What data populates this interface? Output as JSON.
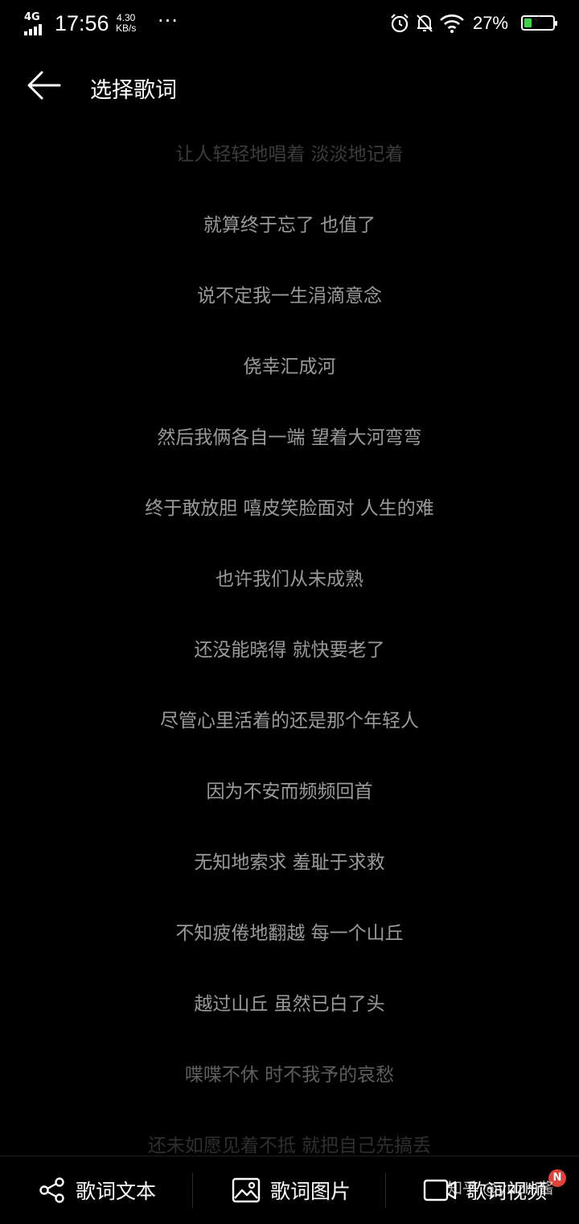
{
  "status_bar": {
    "network": "4G",
    "time": "17:56",
    "speed_value": "4.30",
    "speed_unit": "KB/s",
    "more": "···",
    "battery_percent": "27%",
    "battery_level": 0.27,
    "battery_color": "#3fd24a",
    "icons": [
      "alarm-icon",
      "notifications-off-icon",
      "wifi-icon",
      "battery-charging-icon"
    ]
  },
  "header": {
    "title": "选择歌词",
    "back_icon": "arrow-left-icon"
  },
  "lyrics": [
    "让人轻轻地唱着 淡淡地记着",
    "就算终于忘了 也值了",
    "说不定我一生涓滴意念",
    "侥幸汇成河",
    "然后我俩各自一端 望着大河弯弯",
    "终于敢放胆 嘻皮笑脸面对 人生的难",
    "也许我们从未成熟",
    "还没能晓得 就快要老了",
    "尽管心里活着的还是那个年轻人",
    "因为不安而频频回首",
    "无知地索求 羞耻于求救",
    "不知疲倦地翻越 每一个山丘",
    "越过山丘 虽然已白了头",
    "喋喋不休 时不我予的哀愁",
    "还未如愿见着不抵 就把自己先搞丢"
  ],
  "bottom_bar": {
    "tabs": [
      {
        "label": "歌词文本",
        "icon": "share-icon"
      },
      {
        "label": "歌词图片",
        "icon": "image-icon"
      },
      {
        "label": "歌词视频",
        "icon": "video-icon"
      }
    ],
    "badge": "N"
  },
  "watermark": "知乎 @yuzhi酱"
}
